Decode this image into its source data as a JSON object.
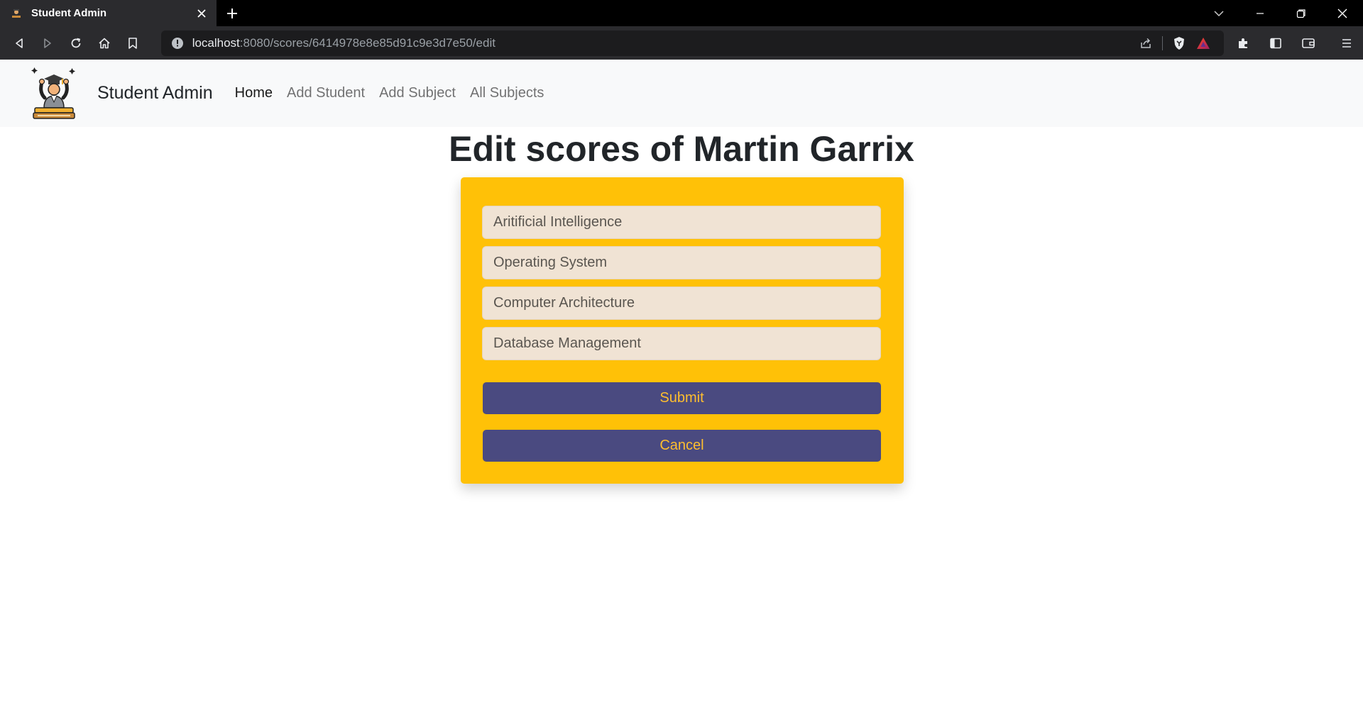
{
  "browser": {
    "tab_title": "Student Admin",
    "url_host": "localhost",
    "url_rest": ":8080/scores/6414978e8e85d91c9e3d7e50/edit"
  },
  "navbar": {
    "brand": "Student Admin",
    "links": [
      "Home",
      "Add Student",
      "Add Subject",
      "All Subjects"
    ],
    "active_link": "Home"
  },
  "page": {
    "title": "Edit scores of Martin Garrix"
  },
  "form": {
    "fields": [
      {
        "placeholder": "Aritificial Intelligence",
        "value": ""
      },
      {
        "placeholder": "Operating System",
        "value": ""
      },
      {
        "placeholder": "Computer Architecture",
        "value": ""
      },
      {
        "placeholder": "Database Management",
        "value": ""
      }
    ],
    "submit_label": "Submit",
    "cancel_label": "Cancel"
  },
  "colors": {
    "card_bg": "#ffc107",
    "button_bg": "#4a4a80",
    "button_text": "#ffbe2e",
    "field_bg": "#f0e3d4",
    "navbar_bg": "#f8f9fa"
  },
  "icons": {
    "toolbar": [
      "back-icon",
      "forward-icon",
      "reload-icon",
      "home-icon",
      "bookmark-icon"
    ],
    "omnibox": [
      "site-info-icon",
      "share-icon",
      "brave-shield-icon",
      "brave-rewards-icon"
    ],
    "extensions": [
      "extensions-icon",
      "sidebar-icon",
      "wallet-icon",
      "menu-icon"
    ]
  }
}
